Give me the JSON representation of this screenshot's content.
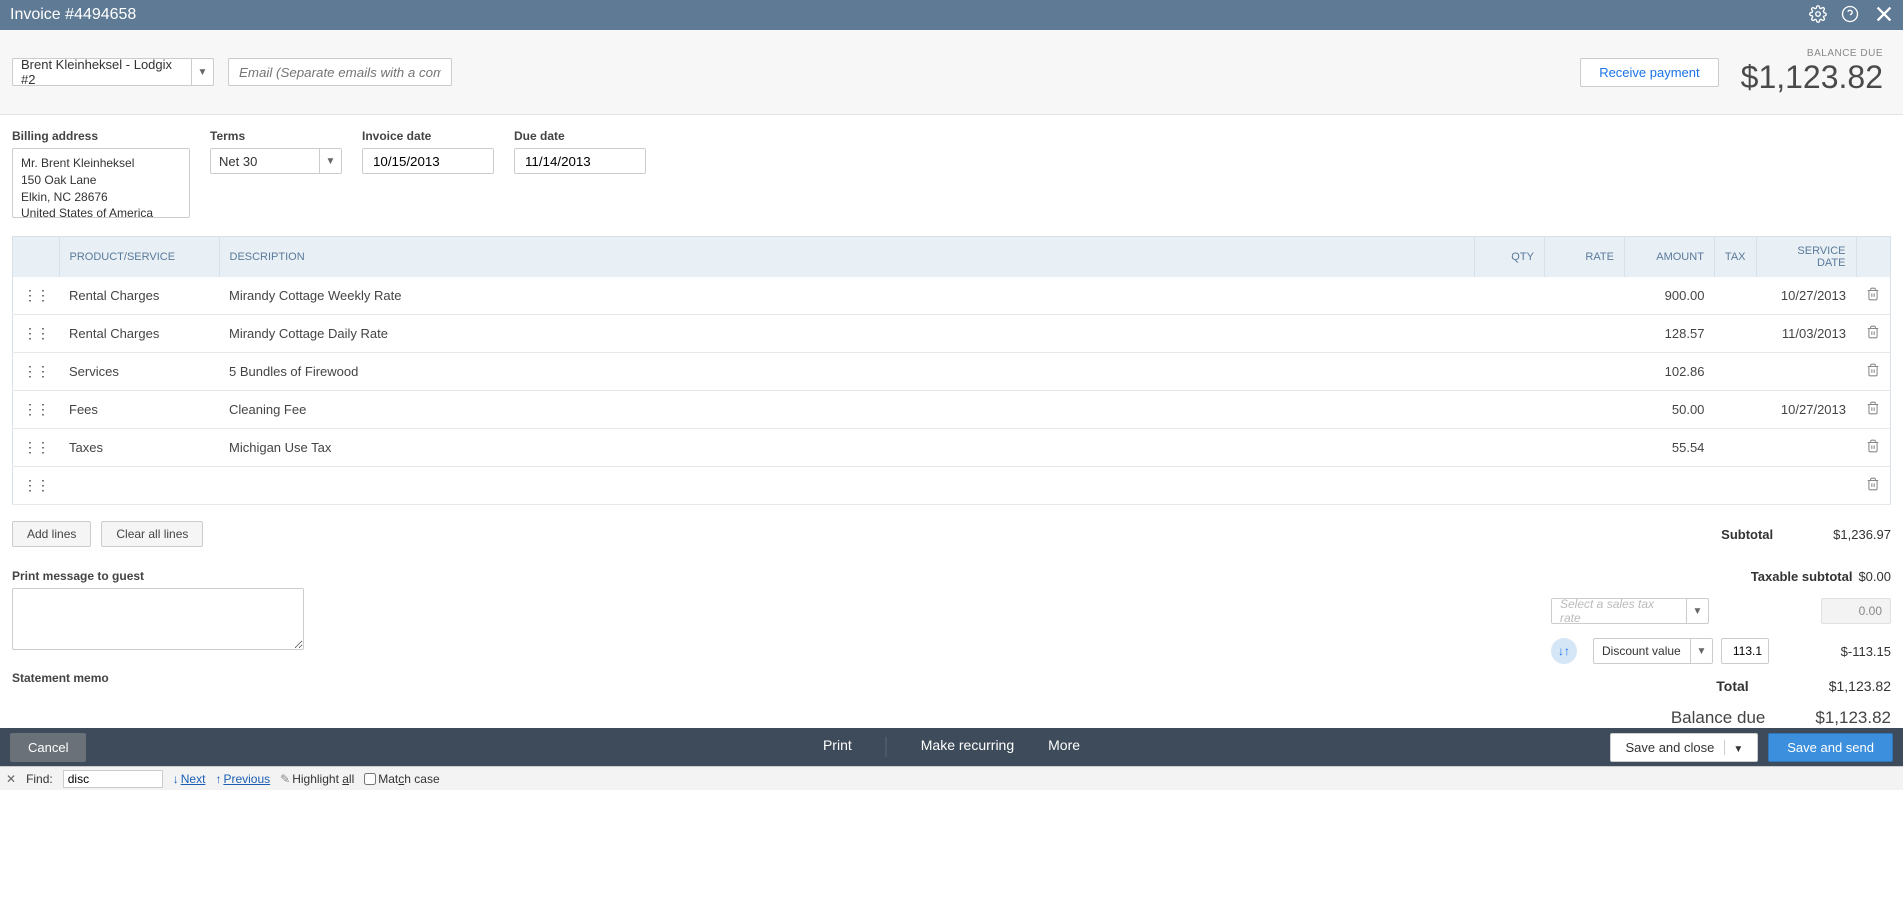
{
  "header": {
    "title": "Invoice #4494658"
  },
  "subheader": {
    "customer_name": "Brent Kleinheksel - Lodgix #2",
    "email_placeholder": "Email (Separate emails with a comma)",
    "receive_payment": "Receive payment",
    "balance_label": "BALANCE DUE",
    "balance_value": "$1,123.82"
  },
  "fields": {
    "billing_label": "Billing address",
    "billing_address": "Mr. Brent Kleinheksel\n150 Oak Lane\nElkin, NC  28676\nUnited States of America",
    "terms_label": "Terms",
    "terms_value": "Net 30",
    "invoice_date_label": "Invoice date",
    "invoice_date": "10/15/2013",
    "due_date_label": "Due date",
    "due_date": "11/14/2013"
  },
  "columns": {
    "product": "PRODUCT/SERVICE",
    "description": "DESCRIPTION",
    "qty": "QTY",
    "rate": "RATE",
    "amount": "AMOUNT",
    "tax": "TAX",
    "service_date": "SERVICE DATE"
  },
  "lines": [
    {
      "product": "Rental Charges",
      "description": "Mirandy Cottage Weekly Rate",
      "qty": "",
      "rate": "",
      "amount": "900.00",
      "tax": "",
      "service_date": "10/27/2013"
    },
    {
      "product": "Rental Charges",
      "description": "Mirandy Cottage Daily Rate",
      "qty": "",
      "rate": "",
      "amount": "128.57",
      "tax": "",
      "service_date": "11/03/2013"
    },
    {
      "product": "Services",
      "description": "5 Bundles of Firewood",
      "qty": "",
      "rate": "",
      "amount": "102.86",
      "tax": "",
      "service_date": ""
    },
    {
      "product": "Fees",
      "description": "Cleaning Fee",
      "qty": "",
      "rate": "",
      "amount": "50.00",
      "tax": "",
      "service_date": "10/27/2013"
    },
    {
      "product": "Taxes",
      "description": "Michigan Use Tax",
      "qty": "",
      "rate": "",
      "amount": "55.54",
      "tax": "",
      "service_date": ""
    },
    {
      "product": "",
      "description": "",
      "qty": "",
      "rate": "",
      "amount": "",
      "tax": "",
      "service_date": ""
    }
  ],
  "table_actions": {
    "add_lines": "Add lines",
    "clear_all": "Clear all lines"
  },
  "totals": {
    "subtotal_label": "Subtotal",
    "subtotal": "$1,236.97",
    "taxable_label": "Taxable subtotal",
    "taxable": "$0.00",
    "sales_tax_placeholder": "Select a sales tax rate",
    "sales_tax_amount": "0.00",
    "discount_label": "Discount value",
    "discount_input": "113.1",
    "discount_amount": "$-113.15",
    "total_label": "Total",
    "total": "$1,123.82",
    "balance_due_label": "Balance due",
    "balance_due": "$1,123.82"
  },
  "memos": {
    "print_label": "Print message to guest",
    "statement_label": "Statement memo"
  },
  "bottom": {
    "cancel": "Cancel",
    "print": "Print",
    "recurring": "Make recurring",
    "more": "More",
    "save_close": "Save and close",
    "save_send": "Save and send"
  },
  "findbar": {
    "find_label": "Find:",
    "find_value": "disc",
    "next": "Next",
    "previous": "Previous",
    "highlight": "Highlight all",
    "match": "Match case"
  }
}
